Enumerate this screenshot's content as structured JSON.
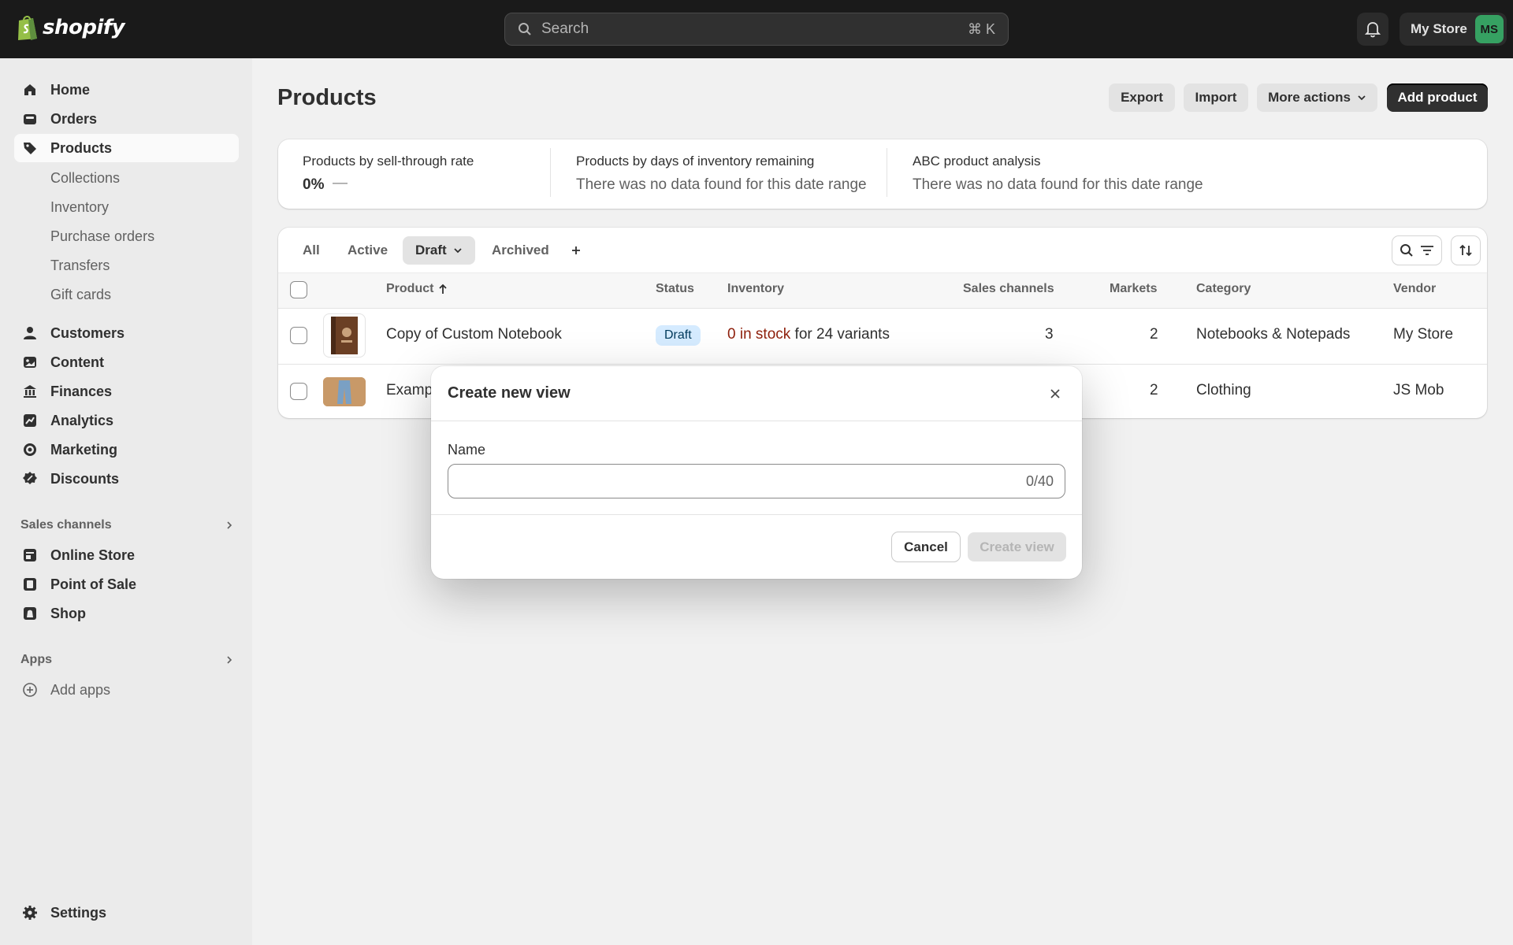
{
  "topbar": {
    "logo_text": "shopify",
    "search_placeholder": "Search",
    "search_shortcut": "⌘ K",
    "store_name": "My Store",
    "avatar_initials": "MS"
  },
  "sidebar": {
    "items": [
      {
        "label": "Home",
        "icon": "home-icon"
      },
      {
        "label": "Orders",
        "icon": "orders-icon"
      },
      {
        "label": "Products",
        "icon": "tag-icon"
      }
    ],
    "product_subitems": [
      "Collections",
      "Inventory",
      "Purchase orders",
      "Transfers",
      "Gift cards"
    ],
    "items2": [
      {
        "label": "Customers",
        "icon": "person-icon"
      },
      {
        "label": "Content",
        "icon": "content-icon"
      },
      {
        "label": "Finances",
        "icon": "bank-icon"
      },
      {
        "label": "Analytics",
        "icon": "chart-icon"
      },
      {
        "label": "Marketing",
        "icon": "target-icon"
      },
      {
        "label": "Discounts",
        "icon": "discount-icon"
      }
    ],
    "sales_channels_title": "Sales channels",
    "sales_channels": [
      {
        "label": "Online Store",
        "icon": "store-icon"
      },
      {
        "label": "Point of Sale",
        "icon": "pos-icon"
      },
      {
        "label": "Shop",
        "icon": "shop-icon"
      }
    ],
    "apps_title": "Apps",
    "add_apps": "Add apps",
    "settings": "Settings"
  },
  "page": {
    "title": "Products",
    "actions": {
      "export": "Export",
      "import": "Import",
      "more": "More actions",
      "add": "Add product"
    }
  },
  "metrics": [
    {
      "label": "Products by sell-through rate",
      "value": "0%",
      "dash": "—"
    },
    {
      "label": "Products by days of inventory remaining",
      "text": "There was no data found for this date range"
    },
    {
      "label": "ABC product analysis",
      "text": "There was no data found for this date range"
    }
  ],
  "tabs": [
    "All",
    "Active",
    "Draft",
    "Archived"
  ],
  "table": {
    "headers": {
      "product": "Product",
      "status": "Status",
      "inventory": "Inventory",
      "sales_channels": "Sales channels",
      "markets": "Markets",
      "category": "Category",
      "vendor": "Vendor"
    },
    "rows": [
      {
        "name": "Copy of Custom Notebook",
        "status": "Draft",
        "inventory_stock": "0 in stock",
        "inventory_variants": "for 24 variants",
        "sales_channels": "3",
        "markets": "2",
        "category": "Notebooks & Notepads",
        "vendor": "My Store"
      },
      {
        "name": "Examp",
        "markets": "2",
        "category": "Clothing",
        "vendor": "JS Mob"
      }
    ]
  },
  "modal": {
    "title": "Create new view",
    "name_label": "Name",
    "name_value": "",
    "counter": "0/40",
    "cancel": "Cancel",
    "create": "Create view"
  },
  "colors": {
    "topbar": "#1a1a1a",
    "primary_button": "#303030",
    "avatar": "#36a162",
    "draft_badge": "#d5ebff",
    "out_of_stock": "#8e1f0b"
  }
}
